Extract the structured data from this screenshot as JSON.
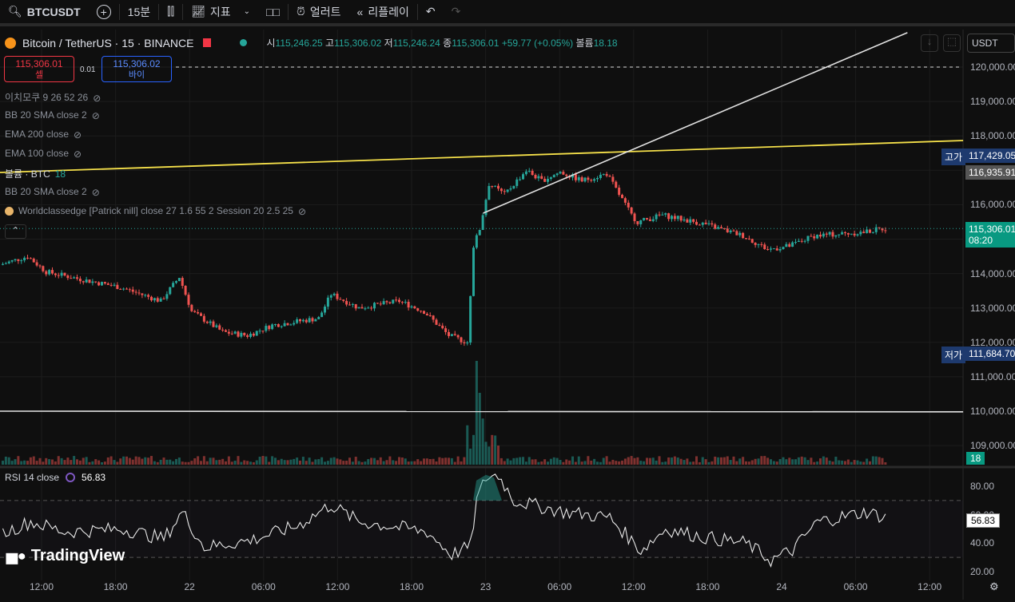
{
  "toolbar": {
    "symbol": "BTCUSDT",
    "interval": "15분",
    "indicators": "지표",
    "alert": "얼러트",
    "replay": "리플레이"
  },
  "header": {
    "title": "Bitcoin / TetherUS · 15 · BINANCE",
    "o_label": "시",
    "o": "115,246.25",
    "h_label": "고",
    "h": "115,306.02",
    "l_label": "저",
    "l": "115,246.24",
    "c_label": "종",
    "c": "115,306.01",
    "change": "+59.77 (+0.05%)",
    "vol_label": "볼륨",
    "vol": "18.18"
  },
  "trade": {
    "sell_price": "115,306.01",
    "sell_label": "셀",
    "spread": "0.01",
    "buy_price": "115,306.02",
    "buy_label": "바이"
  },
  "currency": "USDT",
  "indicators": [
    {
      "label": "이치모쿠 9 26 52 26"
    },
    {
      "label": "BB 20 SMA close 2"
    },
    {
      "label": "EMA 200 close"
    },
    {
      "label": "EMA 100 close"
    },
    {
      "label": "볼륨 · BTC",
      "value": "18"
    },
    {
      "label": "BB 20 SMA close 2"
    },
    {
      "label": "Worldclassedge [Patrick nill] close 27 1.6 55 2 Session 20 2.5 25"
    }
  ],
  "price_axis": [
    "120,000.00",
    "119,000.00",
    "118,000.00",
    "117,000.00",
    "116,000.00",
    "115,000.00",
    "114,000.00",
    "113,000.00",
    "112,000.00",
    "111,000.00",
    "110,000.00",
    "109,000.00"
  ],
  "axis_tags": {
    "high_label": "고가",
    "high": "117,429.05",
    "mid": "116,935.91",
    "last": "115,306.01",
    "countdown": "08:20",
    "low_label": "저가",
    "low": "111,684.70",
    "volume": "18"
  },
  "rsi": {
    "label": "RSI 14 close",
    "value": "56.83",
    "axis": [
      "80.00",
      "60.00",
      "40.00",
      "20.00"
    ]
  },
  "time_axis": [
    "12:00",
    "18:00",
    "22",
    "06:00",
    "12:00",
    "18:00",
    "23",
    "06:00",
    "12:00",
    "18:00",
    "24",
    "06:00",
    "12:00"
  ],
  "logo": "TradingView",
  "colors": {
    "up": "#26a69a",
    "down": "#ef5350",
    "trend": "#f5e04a"
  },
  "chart_data": {
    "type": "candlestick",
    "interval": "15m",
    "ylim": [
      108800,
      121000
    ],
    "price_path": [
      [
        0,
        114250
      ],
      [
        9,
        114500
      ],
      [
        15,
        114050
      ],
      [
        28,
        113800
      ],
      [
        39,
        113600
      ],
      [
        52,
        113200
      ],
      [
        58,
        113900
      ],
      [
        62,
        112900
      ],
      [
        72,
        112300
      ],
      [
        80,
        112200
      ],
      [
        88,
        112500
      ],
      [
        103,
        112700
      ],
      [
        107,
        113400
      ],
      [
        116,
        113000
      ],
      [
        129,
        113200
      ],
      [
        137,
        112900
      ],
      [
        145,
        112200
      ],
      [
        151,
        112000
      ],
      [
        153,
        114800
      ],
      [
        155,
        115300
      ],
      [
        158,
        116600
      ],
      [
        163,
        116300
      ],
      [
        170,
        117000
      ],
      [
        175,
        116700
      ],
      [
        181,
        116950
      ],
      [
        188,
        116700
      ],
      [
        196,
        116900
      ],
      [
        204,
        115700
      ],
      [
        206,
        115500
      ],
      [
        214,
        115700
      ],
      [
        227,
        115450
      ],
      [
        240,
        115100
      ],
      [
        248,
        114700
      ],
      [
        255,
        114800
      ],
      [
        263,
        115100
      ],
      [
        279,
        115200
      ],
      [
        285,
        115306
      ]
    ],
    "rsi_path": [
      [
        0,
        47
      ],
      [
        9,
        55
      ],
      [
        20,
        48
      ],
      [
        39,
        50
      ],
      [
        52,
        43
      ],
      [
        58,
        62
      ],
      [
        65,
        37
      ],
      [
        80,
        42
      ],
      [
        95,
        52
      ],
      [
        106,
        67
      ],
      [
        115,
        55
      ],
      [
        125,
        52
      ],
      [
        137,
        48
      ],
      [
        145,
        32
      ],
      [
        151,
        38
      ],
      [
        153,
        70
      ],
      [
        156,
        86
      ],
      [
        160,
        88
      ],
      [
        165,
        70
      ],
      [
        181,
        62
      ],
      [
        196,
        58
      ],
      [
        206,
        35
      ],
      [
        214,
        50
      ],
      [
        227,
        44
      ],
      [
        240,
        40
      ],
      [
        248,
        28
      ],
      [
        255,
        35
      ],
      [
        263,
        55
      ],
      [
        279,
        62
      ],
      [
        285,
        58
      ]
    ],
    "trendlines": [
      {
        "color": "yellow",
        "from": [
          0,
          116937
        ],
        "to": [
          311,
          117865
        ]
      },
      {
        "color": "white",
        "from": [
          156,
          115754
        ],
        "to": [
          293,
          121000
        ]
      },
      {
        "color": "white",
        "from": [
          0,
          110000
        ],
        "to": [
          311,
          109980
        ]
      }
    ]
  }
}
